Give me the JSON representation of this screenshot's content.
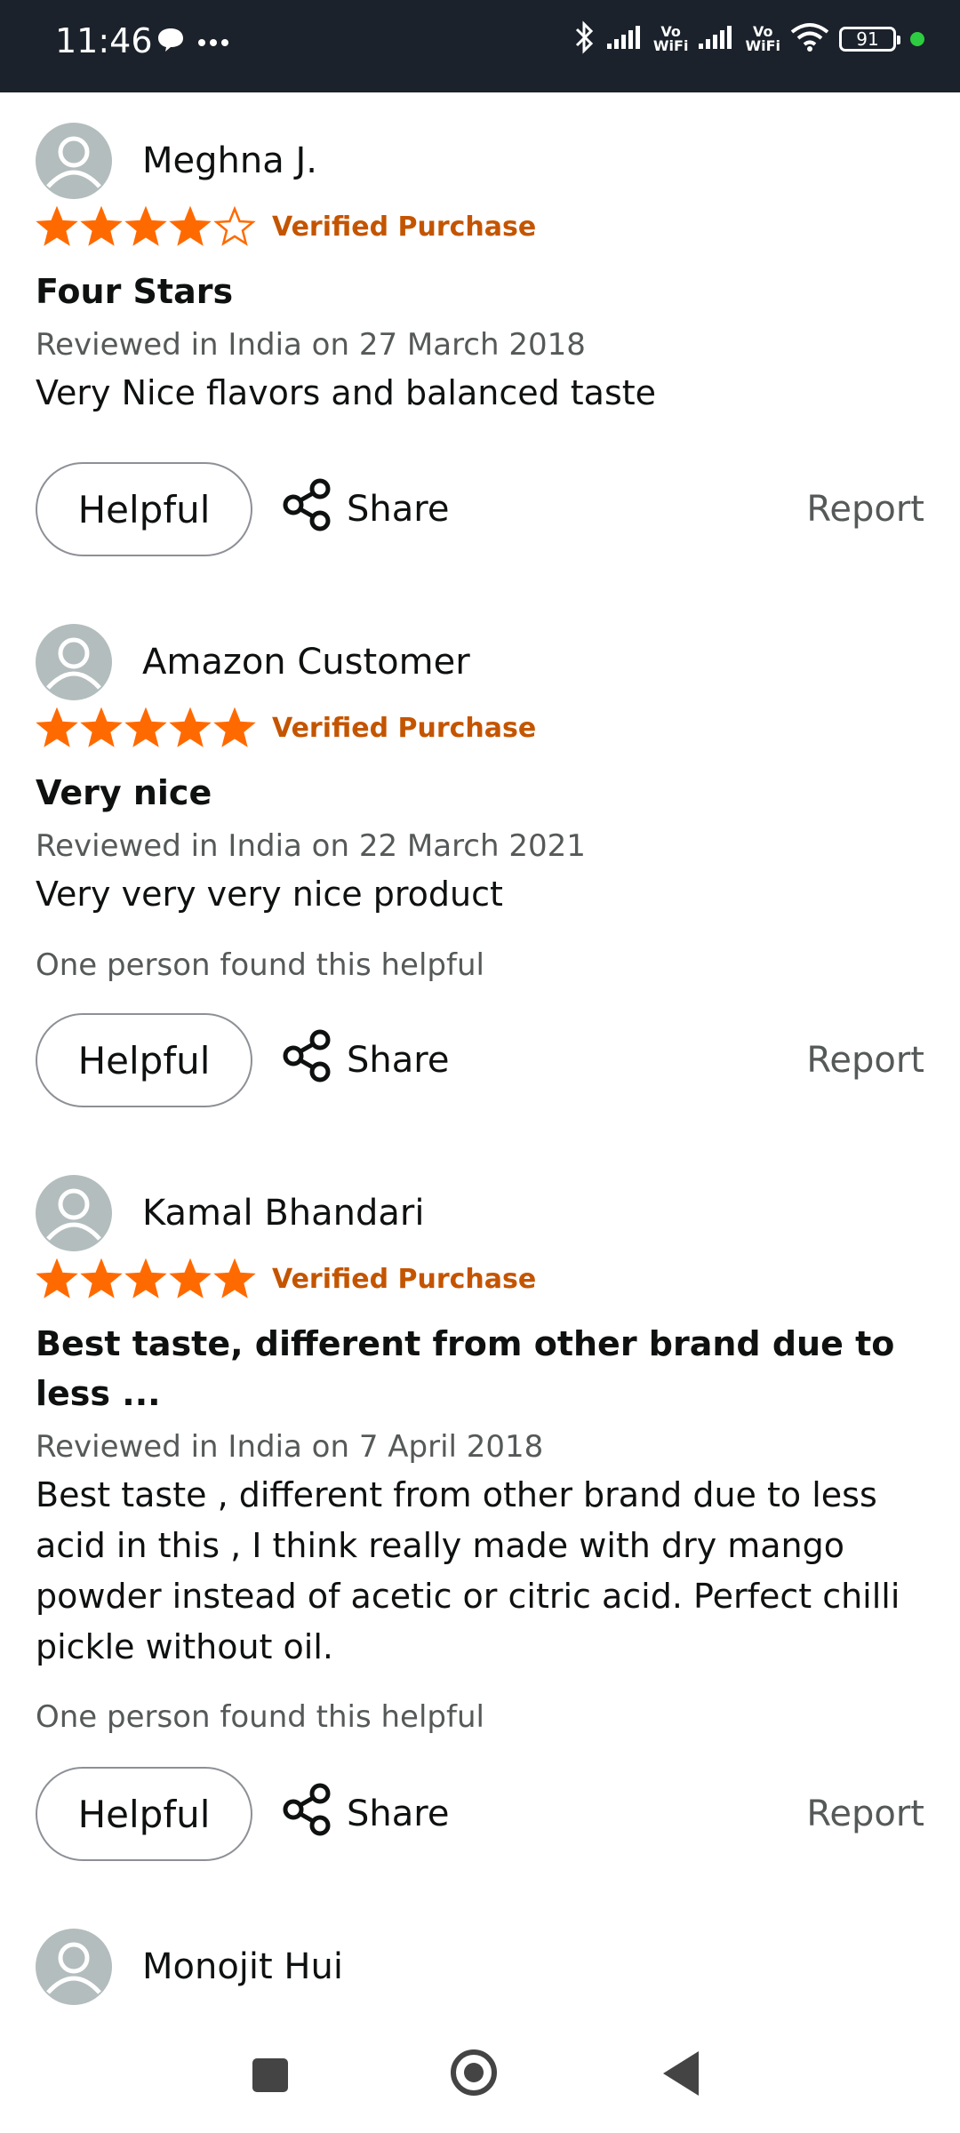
{
  "status_bar": {
    "time": "11:46",
    "net_label_1": "Vo",
    "net_sub_1": "WiFi",
    "net_label_2": "Vo",
    "net_sub_2": "WiFi",
    "battery": "91"
  },
  "reviews": [
    {
      "reviewer": "Meghna J.",
      "rating": 4,
      "rating_max": 5,
      "verified": "Verified Purchase",
      "title": "Four Stars",
      "date": "Reviewed in India on 27 March 2018",
      "body": "Very Nice flavors and balanced taste",
      "helpful_count_text": "",
      "helpful_label": "Helpful",
      "share_label": "Share",
      "report_label": "Report"
    },
    {
      "reviewer": "Amazon Customer",
      "rating": 5,
      "rating_max": 5,
      "verified": "Verified Purchase",
      "title": "Very nice",
      "date": "Reviewed in India on 22 March 2021",
      "body": "Very very very nice product",
      "helpful_count_text": "One person found this helpful",
      "helpful_label": "Helpful",
      "share_label": "Share",
      "report_label": "Report"
    },
    {
      "reviewer": "Kamal Bhandari",
      "rating": 5,
      "rating_max": 5,
      "verified": "Verified Purchase",
      "title": "Best taste, different from other brand due to less ...",
      "date": "Reviewed in India on 7 April 2018",
      "body": "Best taste , different from other brand due to less acid in this , I think really made with dry mango powder instead of acetic or citric acid. Perfect chilli pickle without oil.",
      "helpful_count_text": "One person found this helpful",
      "helpful_label": "Helpful",
      "share_label": "Share",
      "report_label": "Report"
    },
    {
      "reviewer": "Monojit Hui"
    }
  ],
  "colors": {
    "star": "#ff6a00",
    "verified": "#c45500",
    "status_bar_bg": "#1b222b",
    "avatar_bg": "#b3bdbd"
  }
}
